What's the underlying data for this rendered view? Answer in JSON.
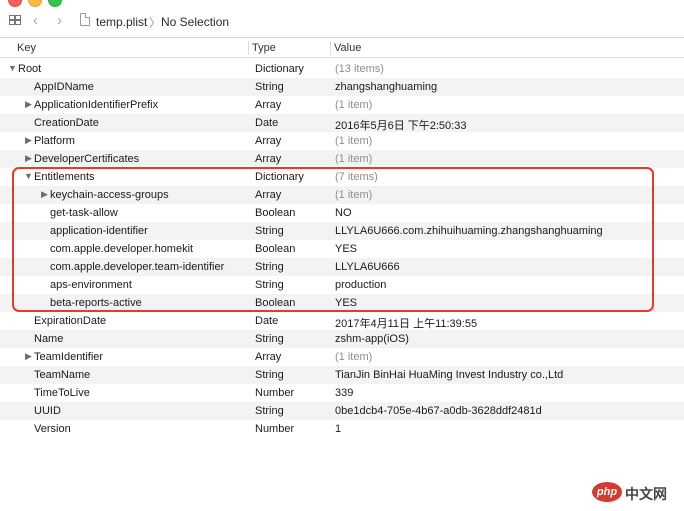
{
  "toolbar": {
    "file_name": "temp.plist",
    "breadcrumb_separator": "〉",
    "selection": "No Selection"
  },
  "columns": {
    "key": "Key",
    "type": "Type",
    "value": "Value"
  },
  "rows": [
    {
      "key": "Root",
      "type": "Dictionary",
      "value": "(13 items)",
      "level": 0,
      "disclosure": "expanded",
      "value_style": "grey"
    },
    {
      "key": "AppIDName",
      "type": "String",
      "value": "zhangshanghuaming",
      "level": 1,
      "disclosure": "none",
      "value_style": "normal"
    },
    {
      "key": "ApplicationIdentifierPrefix",
      "type": "Array",
      "value": "(1 item)",
      "level": 1,
      "disclosure": "collapsed",
      "value_style": "grey"
    },
    {
      "key": "CreationDate",
      "type": "Date",
      "value": "2016年5月6日 下午2:50:33",
      "level": 1,
      "disclosure": "none",
      "value_style": "normal"
    },
    {
      "key": "Platform",
      "type": "Array",
      "value": "(1 item)",
      "level": 1,
      "disclosure": "collapsed",
      "value_style": "grey"
    },
    {
      "key": "DeveloperCertificates",
      "type": "Array",
      "value": "(1 item)",
      "level": 1,
      "disclosure": "collapsed",
      "value_style": "grey"
    },
    {
      "key": "Entitlements",
      "type": "Dictionary",
      "value": "(7 items)",
      "level": 1,
      "disclosure": "expanded",
      "value_style": "grey"
    },
    {
      "key": "keychain-access-groups",
      "type": "Array",
      "value": "(1 item)",
      "level": 2,
      "disclosure": "collapsed",
      "value_style": "grey"
    },
    {
      "key": "get-task-allow",
      "type": "Boolean",
      "value": "NO",
      "level": 2,
      "disclosure": "none",
      "value_style": "normal"
    },
    {
      "key": "application-identifier",
      "type": "String",
      "value": "LLYLA6U666.com.zhihuihuaming.zhangshanghuaming",
      "level": 2,
      "disclosure": "none",
      "value_style": "normal"
    },
    {
      "key": "com.apple.developer.homekit",
      "type": "Boolean",
      "value": "YES",
      "level": 2,
      "disclosure": "none",
      "value_style": "normal"
    },
    {
      "key": "com.apple.developer.team-identifier",
      "type": "String",
      "value": "LLYLA6U666",
      "level": 2,
      "disclosure": "none",
      "value_style": "normal"
    },
    {
      "key": "aps-environment",
      "type": "String",
      "value": "production",
      "level": 2,
      "disclosure": "none",
      "value_style": "normal"
    },
    {
      "key": "beta-reports-active",
      "type": "Boolean",
      "value": "YES",
      "level": 2,
      "disclosure": "none",
      "value_style": "normal"
    },
    {
      "key": "ExpirationDate",
      "type": "Date",
      "value": "2017年4月11日 上午11:39:55",
      "level": 1,
      "disclosure": "none",
      "value_style": "normal"
    },
    {
      "key": "Name",
      "type": "String",
      "value": "zshm-app(iOS)",
      "level": 1,
      "disclosure": "none",
      "value_style": "normal"
    },
    {
      "key": "TeamIdentifier",
      "type": "Array",
      "value": "(1 item)",
      "level": 1,
      "disclosure": "collapsed",
      "value_style": "grey"
    },
    {
      "key": "TeamName",
      "type": "String",
      "value": "TianJin BinHai HuaMing Invest Industry co.,Ltd",
      "level": 1,
      "disclosure": "none",
      "value_style": "normal"
    },
    {
      "key": "TimeToLive",
      "type": "Number",
      "value": "339",
      "level": 1,
      "disclosure": "none",
      "value_style": "normal"
    },
    {
      "key": "UUID",
      "type": "String",
      "value": "0be1dcb4-705e-4b67-a0db-3628ddf2481d",
      "level": 1,
      "disclosure": "none",
      "value_style": "normal"
    },
    {
      "key": "Version",
      "type": "Number",
      "value": "1",
      "level": 1,
      "disclosure": "none",
      "value_style": "normal"
    }
  ],
  "watermark": {
    "badge": "php",
    "text": "中文网"
  },
  "colors": {
    "highlight_border": "#e8392c",
    "alt_row": "#f3f3f3",
    "grey_value": "#8e8e8e"
  },
  "icons": {
    "expanded": "▼",
    "collapsed": "▶"
  }
}
